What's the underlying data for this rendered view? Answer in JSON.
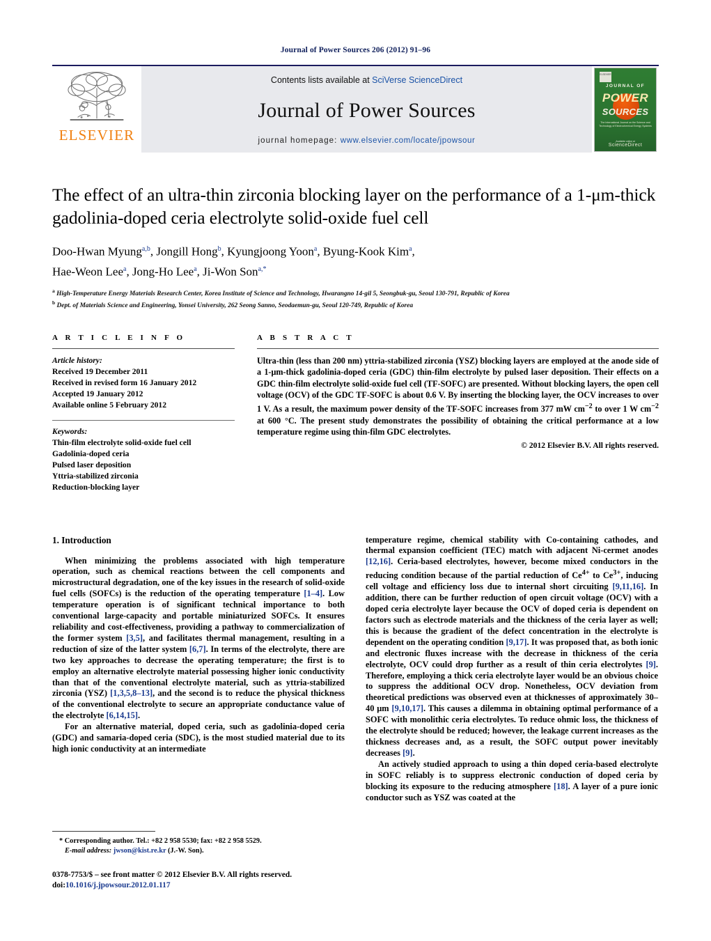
{
  "running_head": "Journal of Power Sources 206 (2012) 91–96",
  "masthead": {
    "publisher_name": "ELSEVIER",
    "contents_prefix": "Contents lists available at ",
    "contents_link": "SciVerse ScienceDirect",
    "journal_name": "Journal of Power Sources",
    "homepage_label": "journal homepage: ",
    "homepage_url": "www.elsevier.com/locate/jpowsour",
    "cover": {
      "badge": "ELSEVIER",
      "line1": "JOURNAL OF",
      "line2": "POWER",
      "line3": "SOURCES",
      "subtitle": "The International Journal on the Science and Technology of Electrochemical Energy Systems",
      "footer_note": "Available online at",
      "footer_logo": "ScienceDirect"
    }
  },
  "article": {
    "title": "The effect of an ultra-thin zirconia blocking layer on the performance of a 1-μm-thick gadolinia-doped ceria electrolyte solid-oxide fuel cell",
    "authors_line1": "Doo-Hwan Myung",
    "authors_line1_sup": "a,b",
    "authors": [
      {
        "name": "Doo-Hwan Myung",
        "sup": "a,b"
      },
      {
        "name": "Jongill Hong",
        "sup": "b"
      },
      {
        "name": "Kyungjoong Yoon",
        "sup": "a"
      },
      {
        "name": "Byung-Kook Kim",
        "sup": "a"
      },
      {
        "name": "Hae-Weon Lee",
        "sup": "a"
      },
      {
        "name": "Jong-Ho Lee",
        "sup": "a"
      },
      {
        "name": "Ji-Won Son",
        "sup": "a,*"
      }
    ],
    "affiliations": [
      {
        "marker": "a",
        "text": "High-Temperature Energy Materials Research Center, Korea Institute of Science and Technology, Hwarangno 14-gil 5, Seongbuk-gu, Seoul 130-791, Republic of Korea"
      },
      {
        "marker": "b",
        "text": "Dept. of Materials Science and Engineering, Yonsei University, 262 Seong Sanno, Seodaemun-gu, Seoul 120-749, Republic of Korea"
      }
    ]
  },
  "article_info": {
    "heading": "A R T I C L E  I N F O",
    "history_label": "Article history:",
    "history": [
      "Received 19 December 2011",
      "Received in revised form 16 January 2012",
      "Accepted 19 January 2012",
      "Available online 5 February 2012"
    ],
    "keywords_label": "Keywords:",
    "keywords": [
      "Thin-film electrolyte solid-oxide fuel cell",
      "Gadolinia-doped ceria",
      "Pulsed laser deposition",
      "Yttria-stabilized zirconia",
      "Reduction-blocking layer"
    ]
  },
  "abstract": {
    "heading": "A B S T R A C T",
    "text": "Ultra-thin (less than 200 nm) yttria-stabilized zirconia (YSZ) blocking layers are employed at the anode side of a 1-μm-thick gadolinia-doped ceria (GDC) thin-film electrolyte by pulsed laser deposition. Their effects on a GDC thin-film electrolyte solid-oxide fuel cell (TF-SOFC) are presented. Without blocking layers, the open cell voltage (OCV) of the GDC TF-SOFC is about 0.6 V. By inserting the blocking layer, the OCV increases to over 1 V. As a result, the maximum power density of the TF-SOFC increases from 377 mW cm−2 to over 1 W cm−2 at 600 °C. The present study demonstrates the possibility of obtaining the critical performance at a low temperature regime using thin-film GDC electrolytes.",
    "copyright": "© 2012 Elsevier B.V. All rights reserved."
  },
  "body": {
    "section_number_title": "1.  Introduction",
    "left_paragraphs": [
      "When minimizing the problems associated with high temperature operation, such as chemical reactions between the cell components and microstructural degradation, one of the key issues in the research of solid-oxide fuel cells (SOFCs) is the reduction of the operating temperature [1–4]. Low temperature operation is of significant technical importance to both conventional large-capacity and portable miniaturized SOFCs. It ensures reliability and cost-effectiveness, providing a pathway to commercialization of the former system [3,5], and facilitates thermal management, resulting in a reduction of size of the latter system [6,7]. In terms of the electrolyte, there are two key approaches to decrease the operating temperature; the first is to employ an alternative electrolyte material possessing higher ionic conductivity than that of the conventional electrolyte material, such as yttria-stabilized zirconia (YSZ) [1,3,5,8–13], and the second is to reduce the physical thickness of the conventional electrolyte to secure an appropriate conductance value of the electrolyte [6,14,15].",
      "For an alternative material, doped ceria, such as gadolinia-doped ceria (GDC) and samaria-doped ceria (SDC), is the most studied material due to its high ionic conductivity at an intermediate"
    ],
    "right_paragraphs": [
      "temperature regime, chemical stability with Co-containing cathodes, and thermal expansion coefficient (TEC) match with adjacent Ni-cermet anodes [12,16]. Ceria-based electrolytes, however, become mixed conductors in the reducing condition because of the partial reduction of Ce4+ to Ce3+, inducing cell voltage and efficiency loss due to internal short circuiting [9,11,16]. In addition, there can be further reduction of open circuit voltage (OCV) with a doped ceria electrolyte layer because the OCV of doped ceria is dependent on factors such as electrode materials and the thickness of the ceria layer as well; this is because the gradient of the defect concentration in the electrolyte is dependent on the operating condition [9,17]. It was proposed that, as both ionic and electronic fluxes increase with the decrease in thickness of the ceria electrolyte, OCV could drop further as a result of thin ceria electrolytes [9]. Therefore, employing a thick ceria electrolyte layer would be an obvious choice to suppress the additional OCV drop. Nonetheless, OCV deviation from theoretical predictions was observed even at thicknesses of approximately 30–40 μm [9,10,17]. This causes a dilemma in obtaining optimal performance of a SOFC with monolithic ceria electrolytes. To reduce ohmic loss, the thickness of the electrolyte should be reduced; however, the leakage current increases as the thickness decreases and, as a result, the SOFC output power inevitably decreases [9].",
      "An actively studied approach to using a thin doped ceria-based electrolyte in SOFC reliably is to suppress electronic conduction of doped ceria by blocking its exposure to the reducing atmosphere [18]. A layer of a pure ionic conductor such as YSZ was coated at the"
    ]
  },
  "footer": {
    "corresponding_marker": "*",
    "corresponding_text": "Corresponding author. Tel.: +82 2 958 5530; fax: +82 2 958 5529.",
    "email_label": "E-mail address:",
    "email": "jwson@kist.re.kr",
    "email_owner": "(J.-W. Son).",
    "issn_line": "0378-7753/$ – see front matter © 2012 Elsevier B.V. All rights reserved.",
    "doi_label": "doi:",
    "doi_value": "10.1016/j.jpowsour.2012.01.117"
  },
  "colors": {
    "link_blue": "#1a52a6",
    "ref_blue": "#1a3a8f",
    "elsevier_orange": "#f08010",
    "masthead_bg": "#e8e9ed",
    "cover_green": "#2f7d33"
  }
}
